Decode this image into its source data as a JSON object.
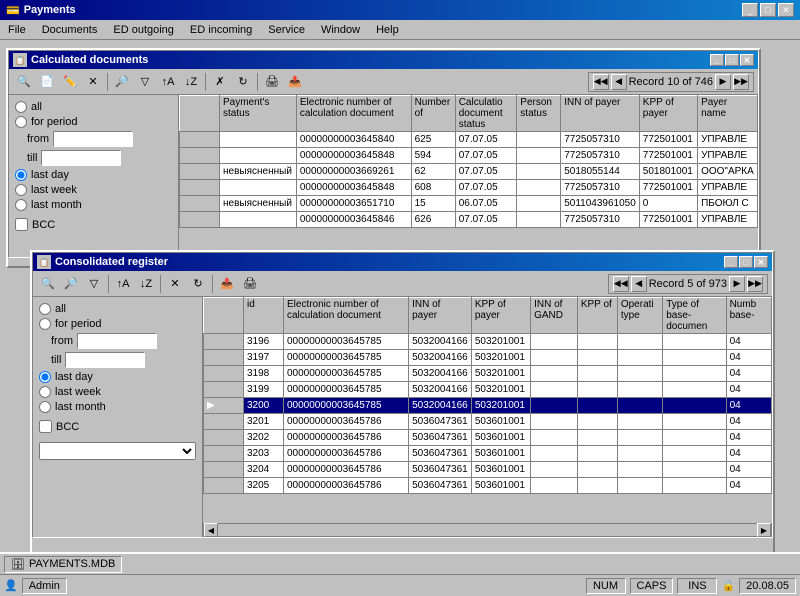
{
  "app": {
    "title": "Payments",
    "icon": "💳"
  },
  "menu": {
    "items": [
      "File",
      "Documents",
      "ED outgoing",
      "ED incoming",
      "Service",
      "Window",
      "Help"
    ]
  },
  "calculated_documents": {
    "title": "Calculated documents",
    "record_info": "Record 10 of 746",
    "filter": {
      "all_label": "all",
      "for_period_label": "for period",
      "from_label": "from",
      "till_label": "till",
      "last_day_label": "last day",
      "last_week_label": "last week",
      "last_month_label": "last month",
      "bcc_label": "BCC"
    },
    "table": {
      "headers": [
        "Payment's status",
        "Electronic number of calculation document",
        "Number of",
        "Calculation document status",
        "Person status",
        "INN of payer",
        "KPP of payer",
        "Payer name"
      ],
      "rows": [
        {
          "status": "",
          "elec_num": "00000000003645840",
          "num": "625",
          "calc_status": "07.07.05",
          "person_status": "",
          "inn": "7725057310",
          "kpp": "772501001",
          "payer": "УПРАВЛЕ"
        },
        {
          "status": "",
          "elec_num": "00000000003645848",
          "num": "594",
          "calc_status": "07.07.05",
          "person_status": "",
          "inn": "7725057310",
          "kpp": "772501001",
          "payer": "УПРАВЛЕ"
        },
        {
          "status": "невыясненный",
          "elec_num": "00000000003669261",
          "num": "62",
          "calc_status": "07.07.05",
          "person_status": "",
          "inn": "5018055144",
          "kpp": "501801001",
          "payer": "ООО\"АРКА"
        },
        {
          "status": "",
          "elec_num": "00000000003645848",
          "num": "608",
          "calc_status": "07.07.05",
          "person_status": "",
          "inn": "7725057310",
          "kpp": "772501001",
          "payer": "УПРАВЛЕ"
        },
        {
          "status": "невыясненный",
          "elec_num": "00000000003651710",
          "num": "15",
          "calc_status": "06.07.05",
          "person_status": "",
          "inn": "5011043961050",
          "kpp": "0",
          "payer": "ПБОЮЛ С"
        },
        {
          "status": "",
          "elec_num": "00000000003645846",
          "num": "626",
          "calc_status": "07.07.05",
          "person_status": "",
          "inn": "7725057310",
          "kpp": "772501001",
          "payer": "УПРАВЛЕ"
        }
      ]
    }
  },
  "consolidated_register": {
    "title": "Consolidated register",
    "record_info": "Record 5 of 973",
    "filter": {
      "all_label": "all",
      "for_period_label": "for period",
      "from_label": "from",
      "till_label": "till",
      "last_day_label": "last day",
      "last_week_label": "last week",
      "last_month_label": "last month",
      "bcc_label": "BCC"
    },
    "table": {
      "headers": [
        "id",
        "Electronic number of calculation document",
        "INN of payer",
        "KPP of payer",
        "INN of GAND",
        "KPP of",
        "Operati type",
        "Type of base-document",
        "Numb base-"
      ],
      "rows": [
        {
          "selected": false,
          "id": "3196",
          "elec_num": "00000000003645785",
          "inn": "5032004166",
          "kpp": "503201001",
          "inn_gand": "",
          "kpp2": "",
          "op_type": "",
          "type_base": "",
          "num_base": "04"
        },
        {
          "selected": false,
          "id": "3197",
          "elec_num": "00000000003645785",
          "inn": "5032004166",
          "kpp": "503201001",
          "inn_gand": "",
          "kpp2": "",
          "op_type": "",
          "type_base": "",
          "num_base": "04"
        },
        {
          "selected": false,
          "id": "3198",
          "elec_num": "00000000003645785",
          "inn": "5032004166",
          "kpp": "503201001",
          "inn_gand": "",
          "kpp2": "",
          "op_type": "",
          "type_base": "",
          "num_base": "04"
        },
        {
          "selected": false,
          "id": "3199",
          "elec_num": "00000000003645785",
          "inn": "5032004166",
          "kpp": "503201001",
          "inn_gand": "",
          "kpp2": "",
          "op_type": "",
          "type_base": "",
          "num_base": "04"
        },
        {
          "selected": true,
          "id": "3200",
          "elec_num": "00000000003645785",
          "inn": "5032004166",
          "kpp": "503201001",
          "inn_gand": "",
          "kpp2": "",
          "op_type": "",
          "type_base": "",
          "num_base": "04"
        },
        {
          "selected": false,
          "id": "3201",
          "elec_num": "00000000003645786",
          "inn": "5036047361",
          "kpp": "503601001",
          "inn_gand": "",
          "kpp2": "",
          "op_type": "",
          "type_base": "",
          "num_base": "04"
        },
        {
          "selected": false,
          "id": "3202",
          "elec_num": "00000000003645786",
          "inn": "5036047361",
          "kpp": "503601001",
          "inn_gand": "",
          "kpp2": "",
          "op_type": "",
          "type_base": "",
          "num_base": "04"
        },
        {
          "selected": false,
          "id": "3203",
          "elec_num": "00000000003645786",
          "inn": "5036047361",
          "kpp": "503601001",
          "inn_gand": "",
          "kpp2": "",
          "op_type": "",
          "type_base": "",
          "num_base": "04"
        },
        {
          "selected": false,
          "id": "3204",
          "elec_num": "00000000003645786",
          "inn": "5036047361",
          "kpp": "503601001",
          "inn_gand": "",
          "kpp2": "",
          "op_type": "",
          "type_base": "",
          "num_base": "04"
        },
        {
          "selected": false,
          "id": "3205",
          "elec_num": "00000000003645786",
          "inn": "5036047361",
          "kpp": "503601001",
          "inn_gand": "",
          "kpp2": "",
          "op_type": "",
          "type_base": "",
          "num_base": "04"
        }
      ]
    }
  },
  "statusbar": {
    "db_label": "PAYMENTS.MDB",
    "user_label": "Admin",
    "num_label": "NUM",
    "caps_label": "CAPS",
    "ins_label": "INS",
    "date_label": "20.08.05"
  },
  "toolbar_icons": {
    "search": "🔍",
    "nav_first": "◀◀",
    "nav_prev": "◀",
    "nav_next": "▶",
    "nav_last": "▶▶"
  }
}
